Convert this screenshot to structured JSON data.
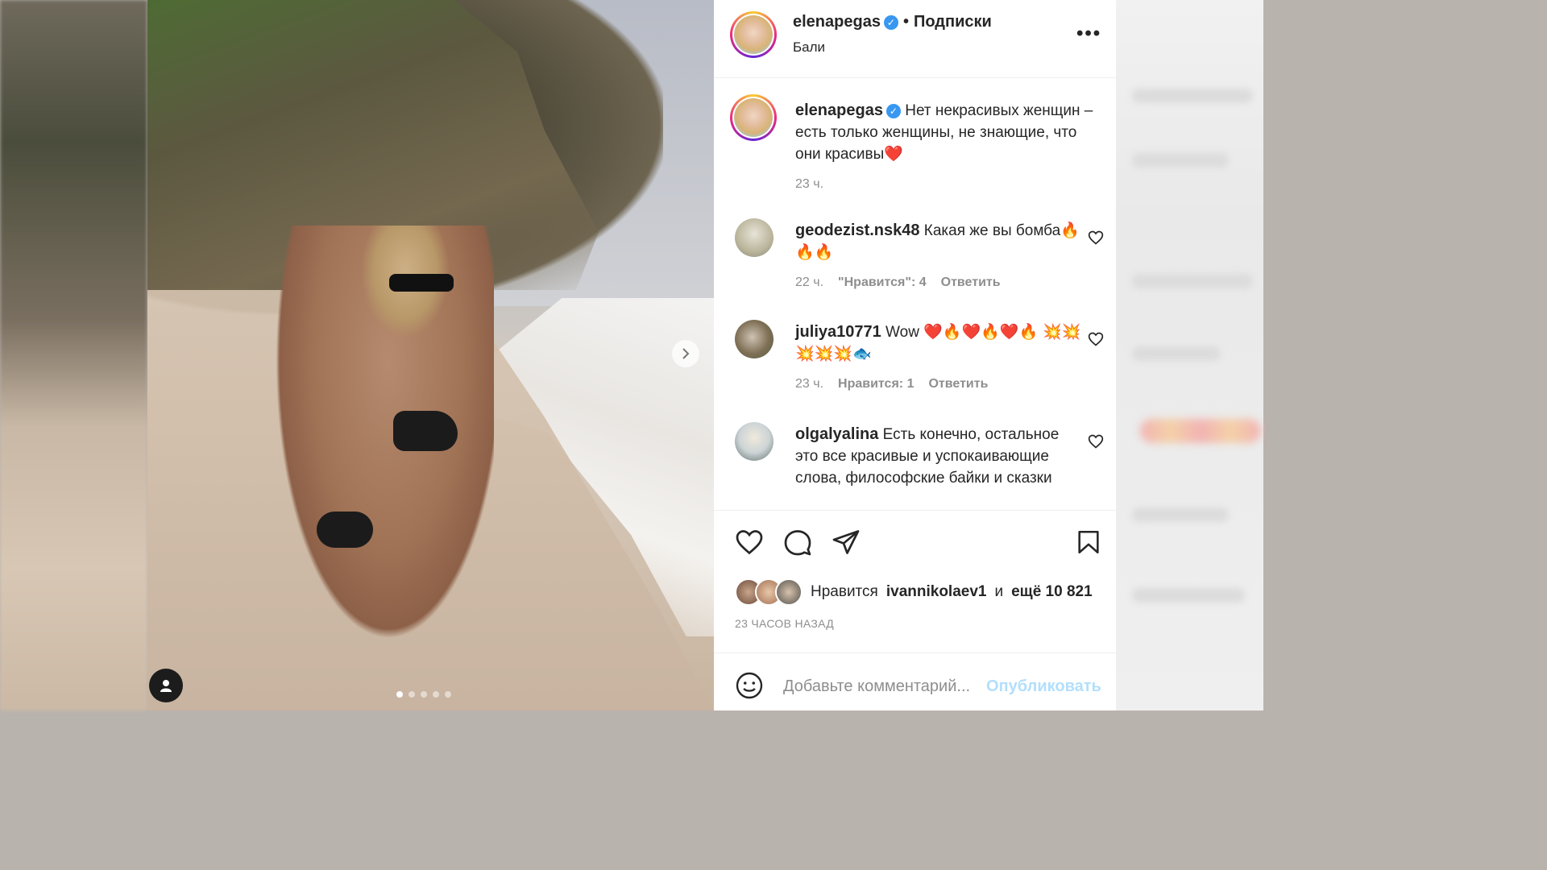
{
  "post": {
    "username": "elenapegas",
    "follow_label": "Подписки",
    "location": "Бали",
    "caption": "Нет некрасивых женщин – есть только женщины, не знающие, что они красивы",
    "caption_emoji": "❤️",
    "caption_time": "23 ч.",
    "image_count": 5,
    "active_image": 1
  },
  "comments": [
    {
      "username": "geodezist.nsk48",
      "text": "Какая же вы бомба",
      "emoji": "🔥🔥🔥",
      "time": "22 ч.",
      "likes_label": "\"Нравится\": 4",
      "reply_label": "Ответить"
    },
    {
      "username": "juliya10771",
      "text": "Wow",
      "emoji": "❤️🔥❤️🔥❤️🔥 💥💥💥💥💥🐟",
      "time": "23 ч.",
      "likes_label": "Нравится: 1",
      "reply_label": "Ответить"
    },
    {
      "username": "olgalyalina",
      "text": "Есть конечно, остальное это все красивые и успокаивающие слова, философские байки и сказки",
      "emoji": "",
      "time": "",
      "likes_label": "",
      "reply_label": ""
    }
  ],
  "likes": {
    "prefix": "Нравится",
    "user": "ivannikolaev1",
    "conj": "и",
    "others": "ещё 10 821"
  },
  "posted_ago": "23 ЧАСОВ НАЗАД",
  "comment_box": {
    "placeholder": "Добавьте комментарий...",
    "publish": "Опубликовать"
  }
}
